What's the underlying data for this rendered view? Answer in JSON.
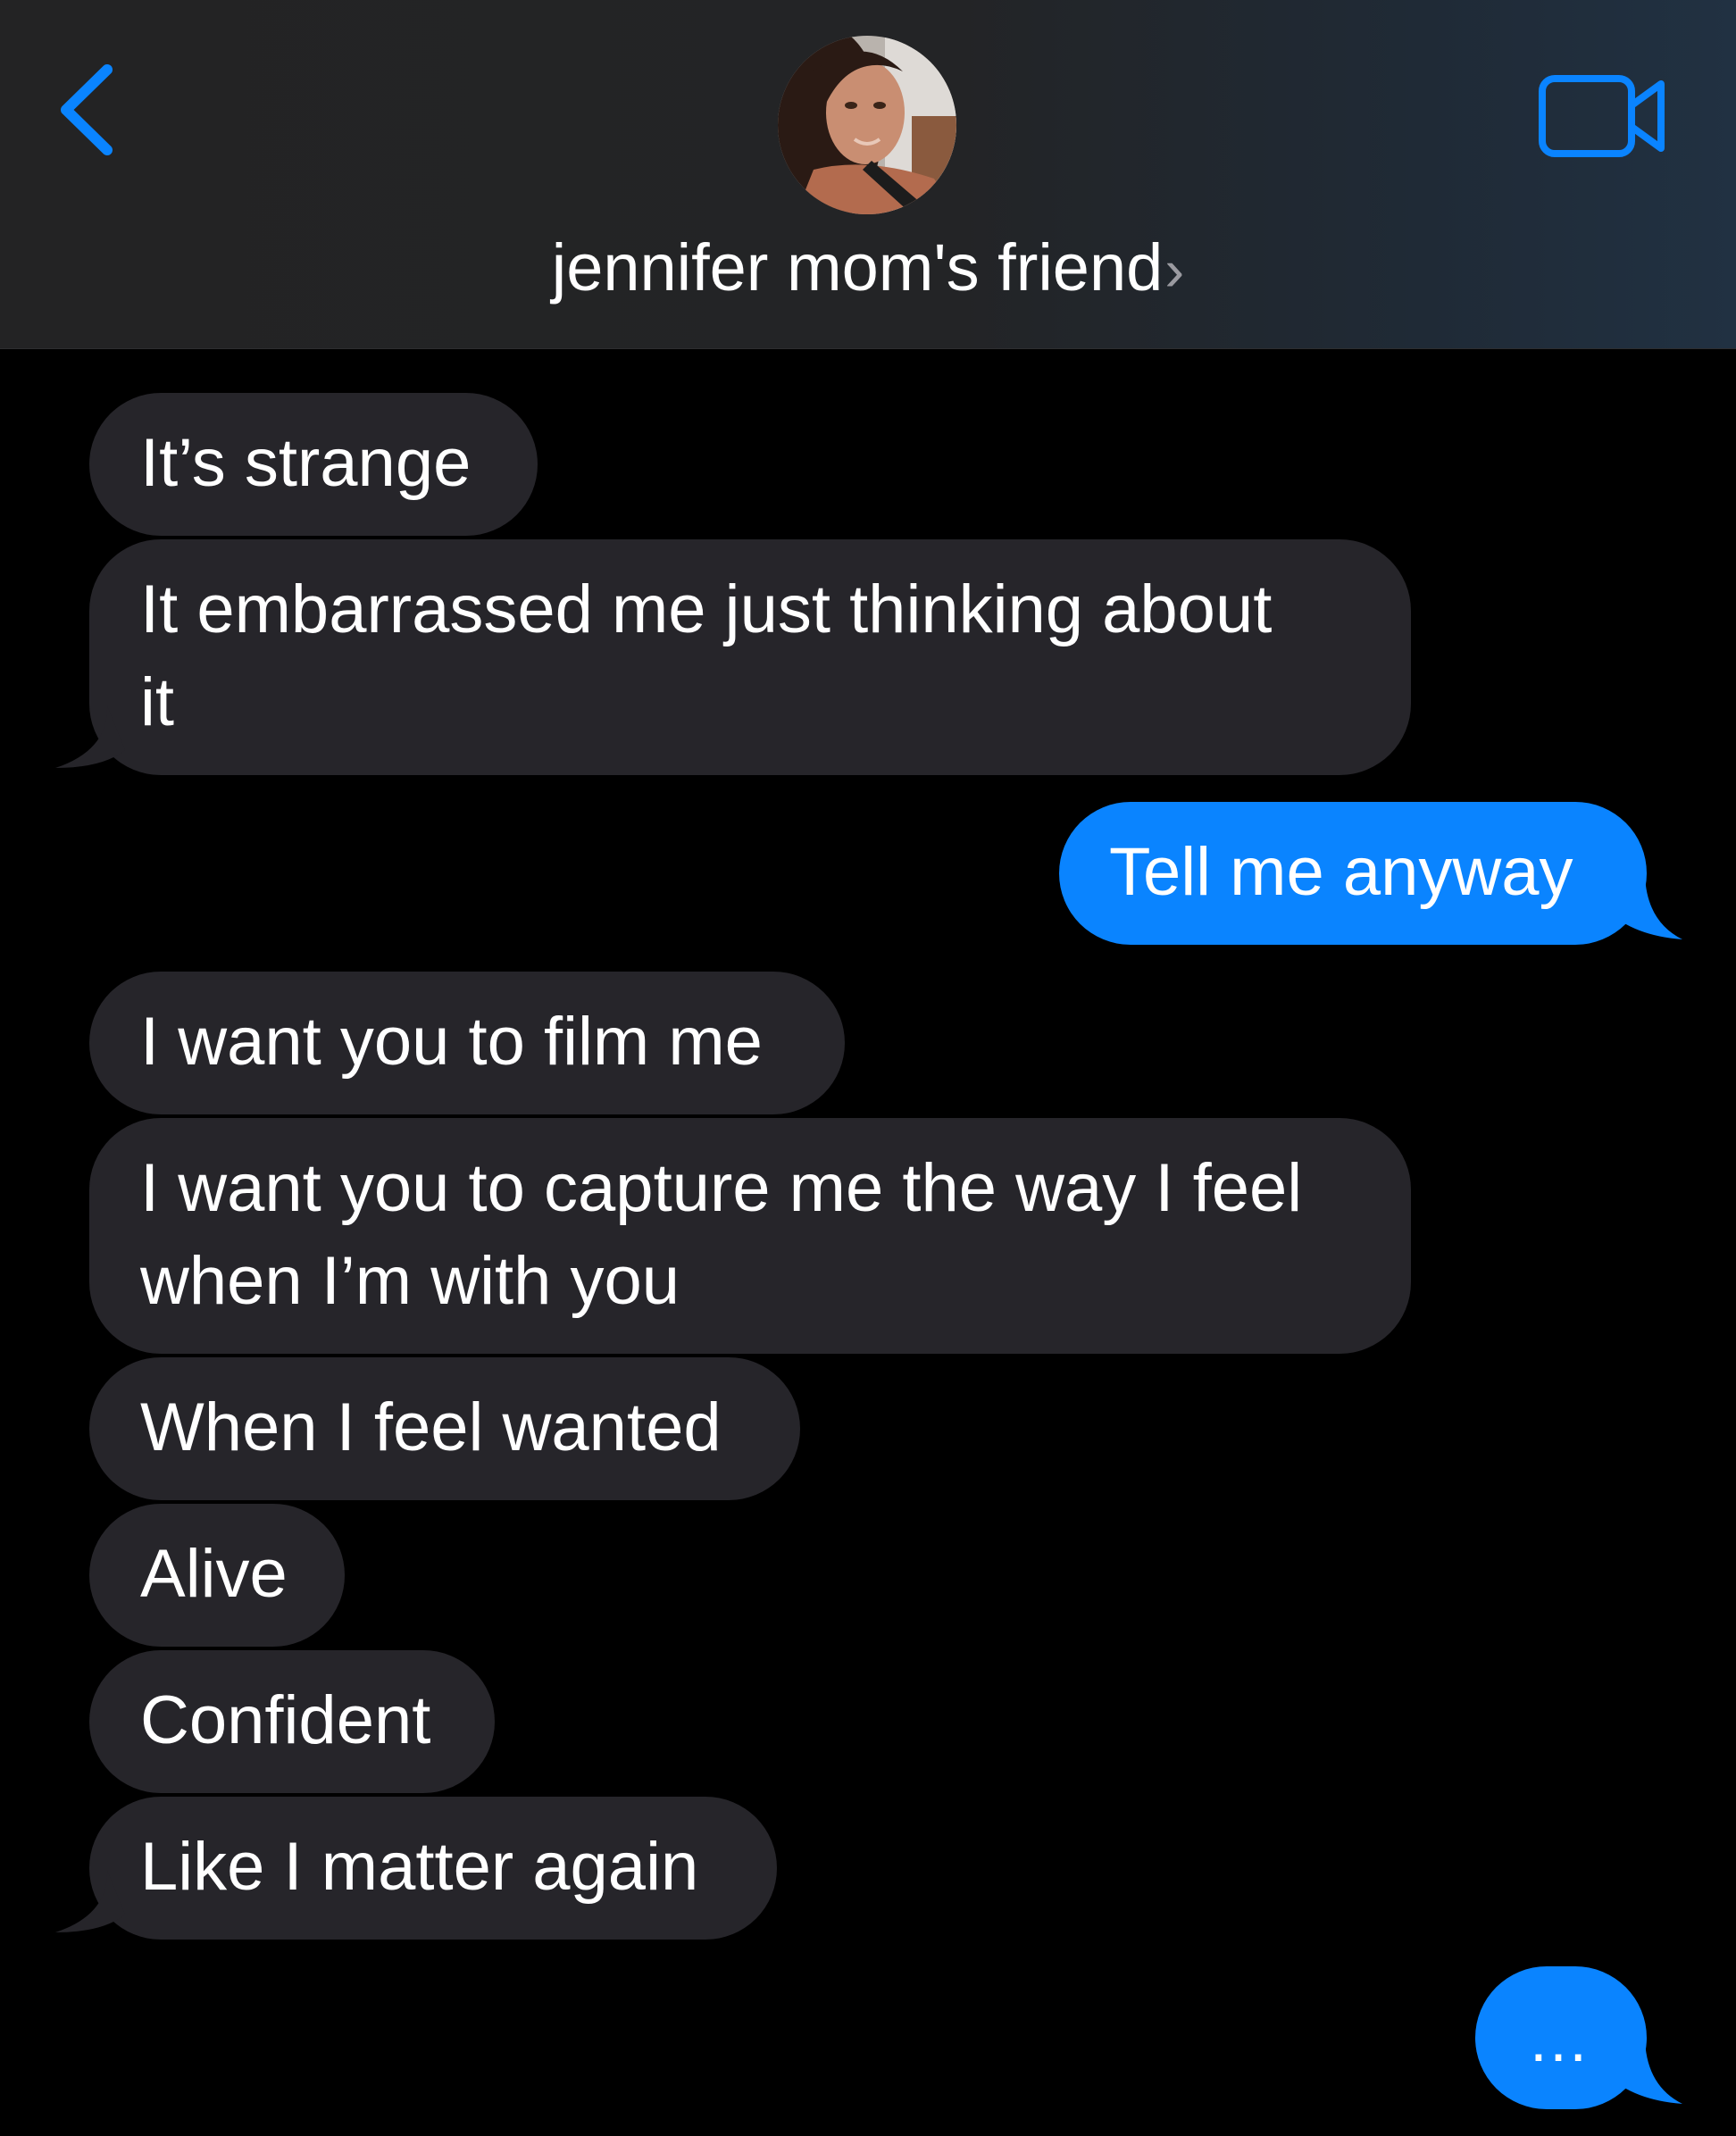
{
  "header": {
    "contact_name": "jennifer mom's friend",
    "chevron": "›",
    "back_icon": "chevron-left-icon",
    "video_icon": "video-camera-icon",
    "accent_color": "#0a84ff"
  },
  "messages": [
    {
      "direction": "incoming",
      "lines": [
        "It’s strange"
      ]
    },
    {
      "direction": "incoming",
      "lines": [
        "It embarrassed me just thinking about",
        "it"
      ]
    },
    {
      "direction": "outgoing",
      "lines": [
        "Tell me anyway"
      ]
    },
    {
      "direction": "incoming",
      "lines": [
        "I want you to film me"
      ]
    },
    {
      "direction": "incoming",
      "lines": [
        "I want you to capture me the way I feel",
        "when I’m with you"
      ]
    },
    {
      "direction": "incoming",
      "lines": [
        "When I feel wanted"
      ]
    },
    {
      "direction": "incoming",
      "lines": [
        "Alive"
      ]
    },
    {
      "direction": "incoming",
      "lines": [
        "Confident"
      ]
    },
    {
      "direction": "incoming",
      "lines": [
        "Like I matter again"
      ]
    }
  ],
  "typing_indicator": "…",
  "colors": {
    "incoming_bubble": "#26252a",
    "outgoing_bubble": "#0a84ff",
    "background": "#000000"
  }
}
